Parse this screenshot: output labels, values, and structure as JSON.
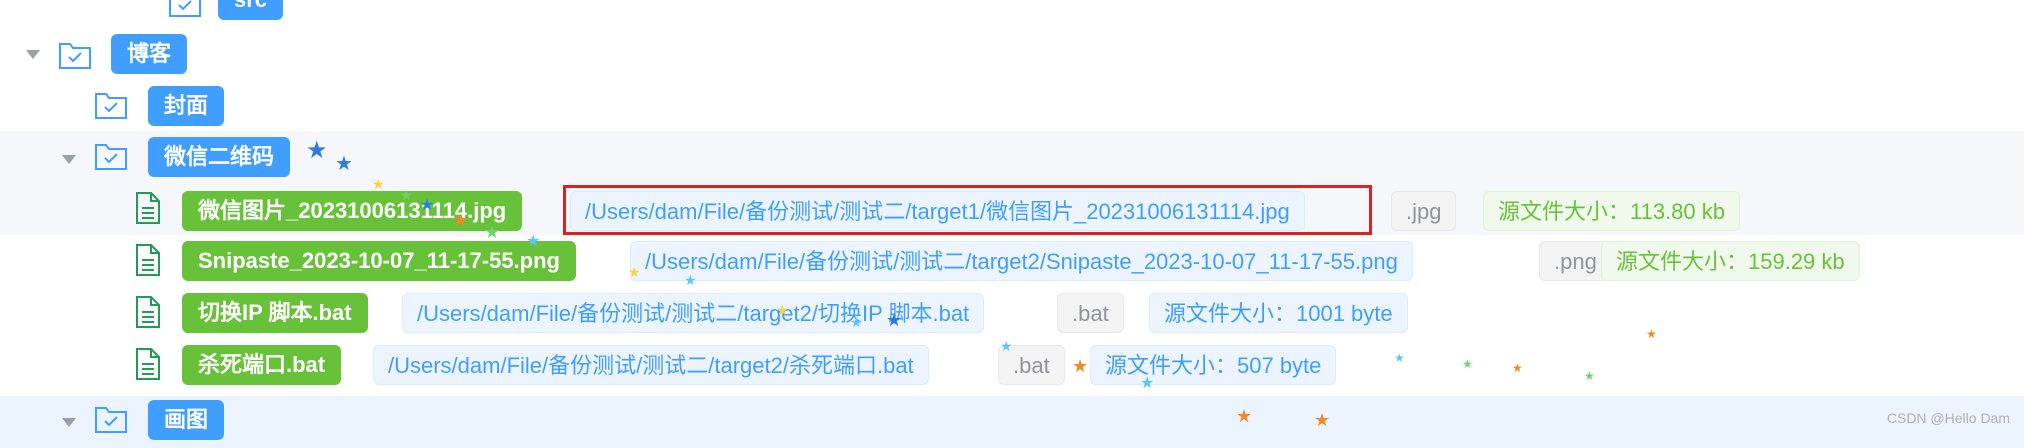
{
  "tree": {
    "partial_folder_top": {
      "label": "src"
    },
    "folder_blog": {
      "label": "博客"
    },
    "folder_cover": {
      "label": "封面"
    },
    "folder_wechat_qr": {
      "label": "微信二维码"
    },
    "files": [
      {
        "name": "微信图片_20231006131114.jpg",
        "path": "/Users/dam/File/备份测试/测试二/target1/微信图片_20231006131114.jpg",
        "ext": ".jpg",
        "size": "源文件大小：113.80 kb"
      },
      {
        "name": "Snipaste_2023-10-07_11-17-55.png",
        "path": "/Users/dam/File/备份测试/测试二/target2/Snipaste_2023-10-07_11-17-55.png",
        "ext": ".png",
        "size": "源文件大小：159.29 kb"
      },
      {
        "name": "切换IP 脚本.bat",
        "path": "/Users/dam/File/备份测试/测试二/target2/切换IP 脚本.bat",
        "ext": ".bat",
        "size": "源文件大小：1001 byte"
      },
      {
        "name": "杀死端口.bat",
        "path": "/Users/dam/File/备份测试/测试二/target2/杀死端口.bat",
        "ext": ".bat",
        "size": "源文件大小：507 byte"
      }
    ],
    "folder_drawing": {
      "label": "画图"
    }
  },
  "watermark": "CSDN @Hello Dam",
  "colors": {
    "primary": "#409eff",
    "success": "#67c23a",
    "highlight_border": "#e02020",
    "row_hover": "#f5f7fa"
  },
  "icons": {
    "folder": "folder-check-icon",
    "file": "document-icon",
    "expand": "caret-down-icon"
  }
}
